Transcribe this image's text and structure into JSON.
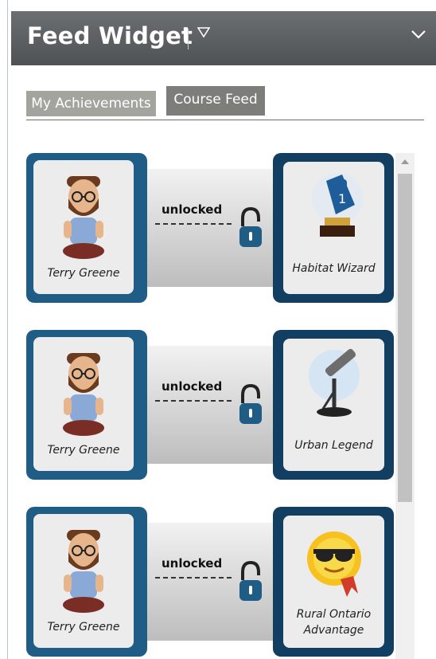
{
  "header": {
    "title": "Feed Widget"
  },
  "tabs": [
    {
      "label": "My Achievements",
      "active": false
    },
    {
      "label": "Course Feed",
      "active": true
    }
  ],
  "status_label": "unlocked",
  "feed": [
    {
      "user": "Terry Greene",
      "achievement": "Habitat Wizard",
      "icon": "foam-finger-trophy-icon"
    },
    {
      "user": "Terry Greene",
      "achievement": "Urban Legend",
      "icon": "telescope-icon"
    },
    {
      "user": "Terry Greene",
      "achievement": "Rural Ontario Advantage",
      "icon": "sun-sunglasses-icon"
    }
  ],
  "colors": {
    "header_bg": "#58595b",
    "user_panel": "#1f5d86",
    "badge_panel": "#123f61",
    "lock": "#1f5d86"
  }
}
